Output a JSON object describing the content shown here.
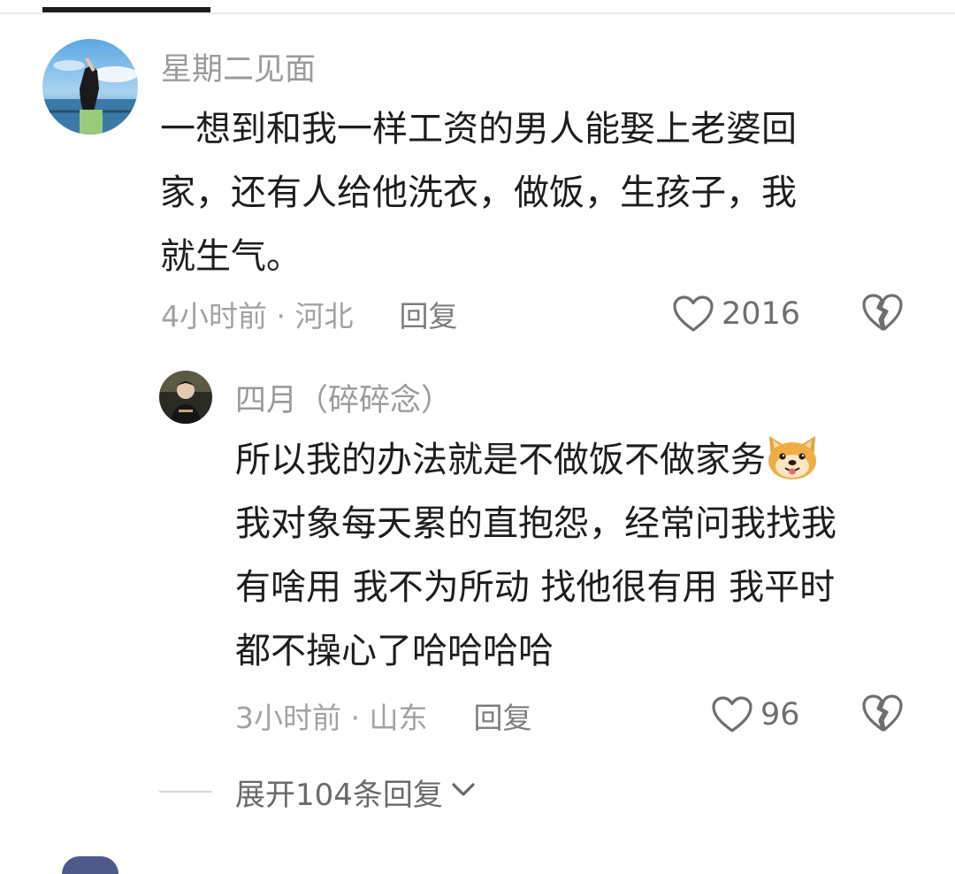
{
  "comments": [
    {
      "username": "星期二见面",
      "text_lines": [
        "一想到和我一样工资的男人能娶上老婆回",
        "家，还有人给他洗衣，做饭，生孩子，我",
        "就生气。"
      ],
      "meta": "4小时前 · 河北",
      "reply_label": "回复",
      "like_count": "2016",
      "replies": [
        {
          "username": "四月（碎碎念）",
          "text_lines": [
            "所以我的办法就是不做饭不做家务",
            "我对象每天累的直抱怨，经常问我找我",
            "有啥用 我不为所动 找他很有用 我平时",
            "都不操心了哈哈哈哈"
          ],
          "emoji": "doge-emoji",
          "meta": "3小时前 · 山东",
          "reply_label": "回复",
          "like_count": "96"
        }
      ]
    }
  ],
  "expand": {
    "label": "展开104条回复"
  },
  "icons": {
    "like": "heart-outline-icon",
    "dislike": "broken-heart-icon",
    "expand": "chevron-down-icon"
  },
  "colors": {
    "username": "#9a9a9a",
    "text": "#1d1d1d",
    "meta": "#a2a2a2",
    "reply": "#7d7d7d"
  }
}
